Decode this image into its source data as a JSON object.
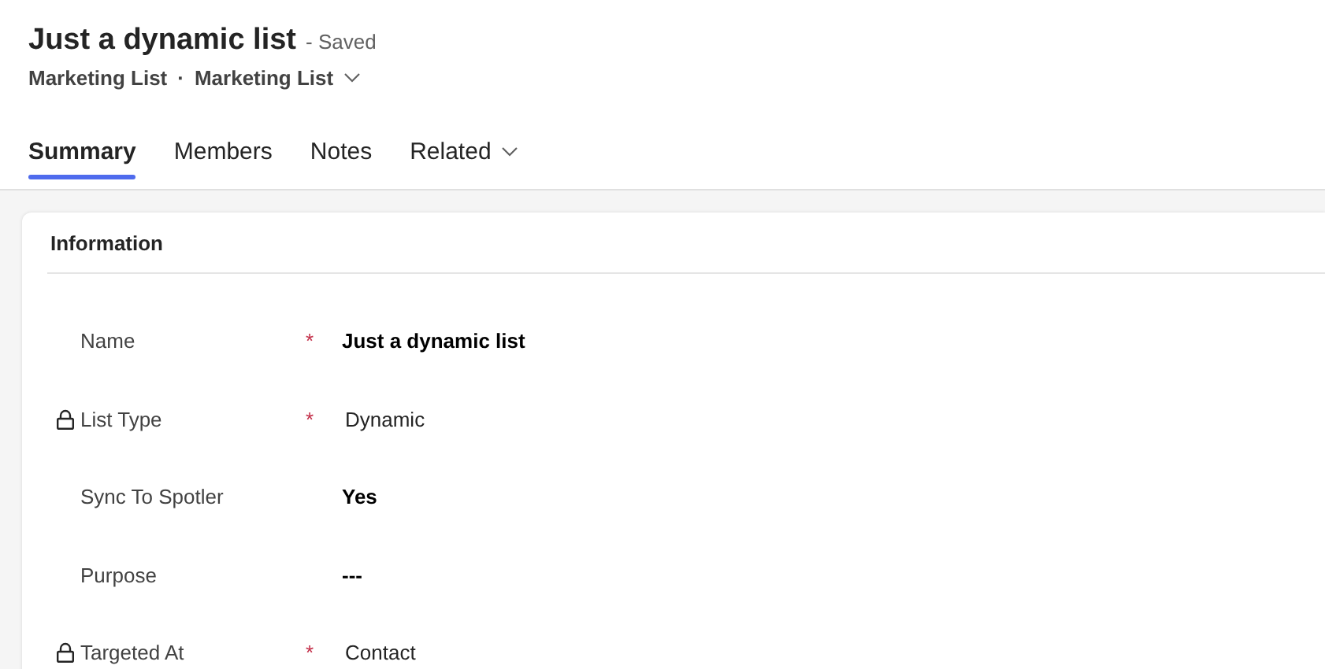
{
  "header": {
    "title": "Just a dynamic list",
    "save_status": "- Saved",
    "entity": "Marketing List",
    "separator": "·",
    "form_name": "Marketing List"
  },
  "tabs": [
    {
      "label": "Summary",
      "selected": true,
      "has_menu": false
    },
    {
      "label": "Members",
      "selected": false,
      "has_menu": false
    },
    {
      "label": "Notes",
      "selected": false,
      "has_menu": false
    },
    {
      "label": "Related",
      "selected": false,
      "has_menu": true
    }
  ],
  "section": {
    "title": "Information",
    "fields": [
      {
        "label": "Name",
        "locked": false,
        "required_marker": "*",
        "value": "Just a dynamic list"
      },
      {
        "label": "List Type",
        "locked": true,
        "required_marker": "*",
        "value": "Dynamic"
      },
      {
        "label": "Sync To Spotler",
        "locked": false,
        "value": "Yes"
      },
      {
        "label": "Purpose",
        "locked": false,
        "value": "---"
      },
      {
        "label": "Targeted At",
        "locked": true,
        "required_marker": "*",
        "value": "Contact"
      }
    ]
  }
}
